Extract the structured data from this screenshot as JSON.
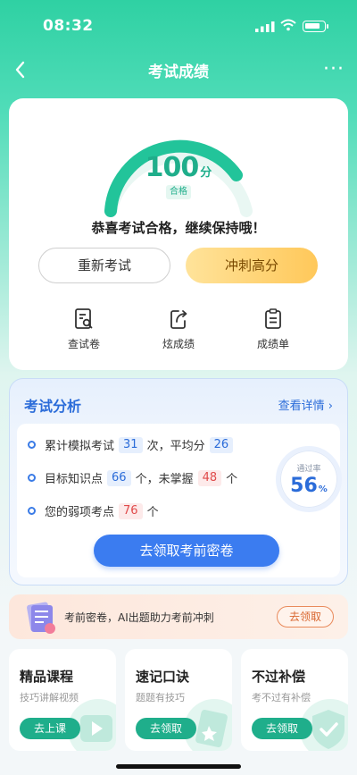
{
  "status": {
    "time": "08:32"
  },
  "nav": {
    "title": "考试成绩",
    "more": "···"
  },
  "score": {
    "value": "100",
    "unit": "分",
    "tag": "合格",
    "message": "恭喜考试合格，继续保持哦！",
    "retry_label": "重新考试",
    "sprint_label": "冲刺高分",
    "actions": [
      {
        "label": "查试卷",
        "icon": "document-search-icon"
      },
      {
        "label": "炫成绩",
        "icon": "share-icon"
      },
      {
        "label": "成绩单",
        "icon": "clipboard-icon"
      }
    ]
  },
  "analysis": {
    "title": "考试分析",
    "more_label": "查看详情",
    "rows": [
      {
        "parts": [
          "累计模拟考试",
          "31",
          "次，平均分",
          "26"
        ]
      },
      {
        "parts": [
          "目标知识点",
          "66",
          "个，未掌握",
          "48",
          "个"
        ]
      },
      {
        "parts": [
          "您的弱项考点",
          "76",
          "个"
        ]
      }
    ],
    "pass_rate_label": "通过率",
    "pass_rate_value": "56",
    "pass_rate_unit": "%",
    "cta_label": "去领取考前密卷"
  },
  "promo": {
    "text": "考前密卷，AI出题助力考前冲刺",
    "button": "去领取"
  },
  "features": [
    {
      "title": "精品课程",
      "subtitle": "技巧讲解视频",
      "button": "去上课",
      "icon": "play-icon"
    },
    {
      "title": "速记口诀",
      "subtitle": "题题有技巧",
      "button": "去领取",
      "icon": "book-icon"
    },
    {
      "title": "不过补偿",
      "subtitle": "考不过有补偿",
      "button": "去领取",
      "icon": "shield-icon"
    }
  ],
  "colors": {
    "accent": "#1fae8b",
    "blue": "#2b6cd9",
    "gold": "#ffc85a"
  }
}
